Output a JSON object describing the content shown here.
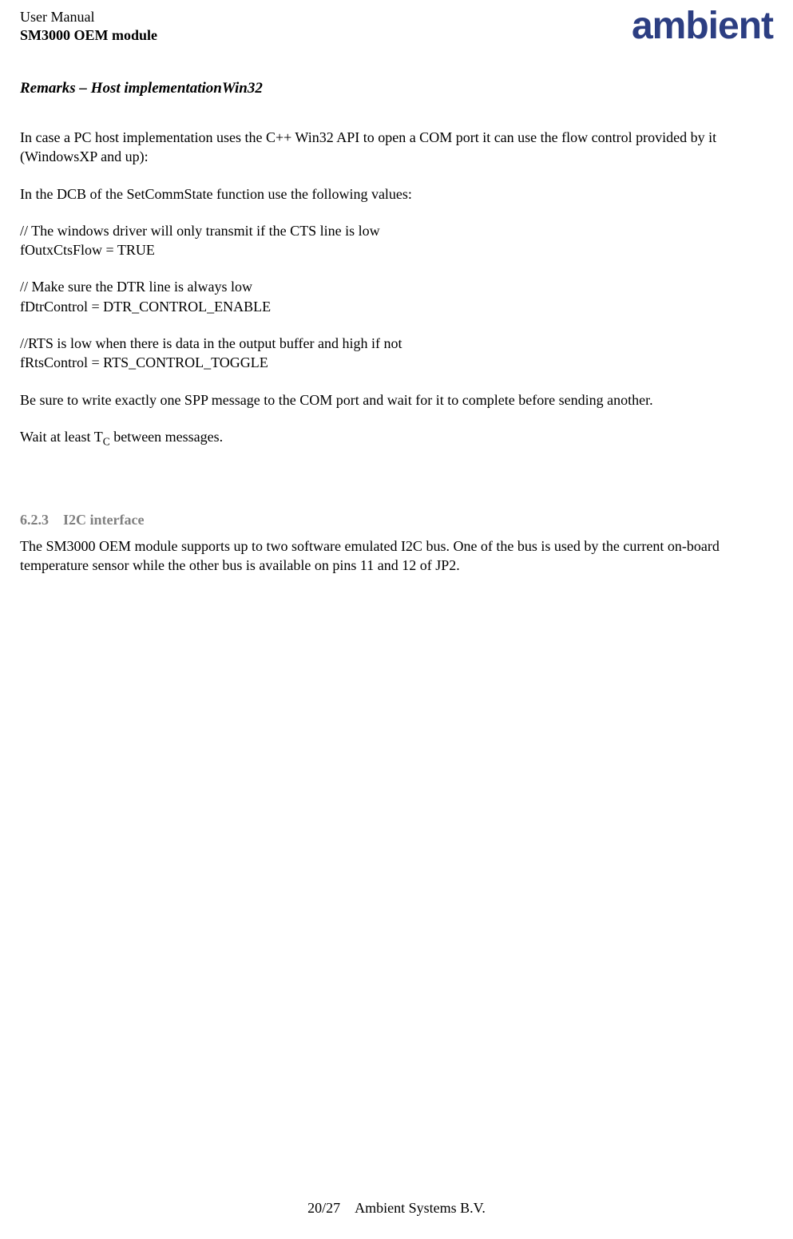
{
  "header": {
    "title": "User Manual",
    "subtitle": "SM3000 OEM module",
    "logo_text": "ambient"
  },
  "section": {
    "heading": "Remarks – Host implementationWin32"
  },
  "body": {
    "p1": "In case a PC host implementation uses the C++ Win32 API to open a COM port it can use the flow control provided by it (WindowsXP and up):",
    "p2": "In the DCB of the SetCommState function use the following values:",
    "p3a": "// The windows driver will only transmit if the CTS line is low",
    "p3b": "fOutxCtsFlow = TRUE",
    "p4a": "// Make sure the DTR line is always low",
    "p4b": "fDtrControl = DTR_CONTROL_ENABLE",
    "p5a": "//RTS is low when there is data in the output buffer and high if not",
    "p5b": "fRtsControl = RTS_CONTROL_TOGGLE",
    "p6": "Be sure to write exactly one SPP message to the COM port and wait for it to complete before sending another.",
    "p7_pre": "Wait at least T",
    "p7_sub": "C",
    "p7_post": " between messages."
  },
  "subsection": {
    "number": "6.2.3",
    "title": "I2C interface",
    "text": "The SM3000 OEM module supports up to two  software emulated I2C bus. One of the bus is used by the current on-board temperature sensor while the other bus is available on pins 11 and 12 of JP2."
  },
  "footer": {
    "page": "20/27",
    "org": "Ambient Systems B.V."
  }
}
